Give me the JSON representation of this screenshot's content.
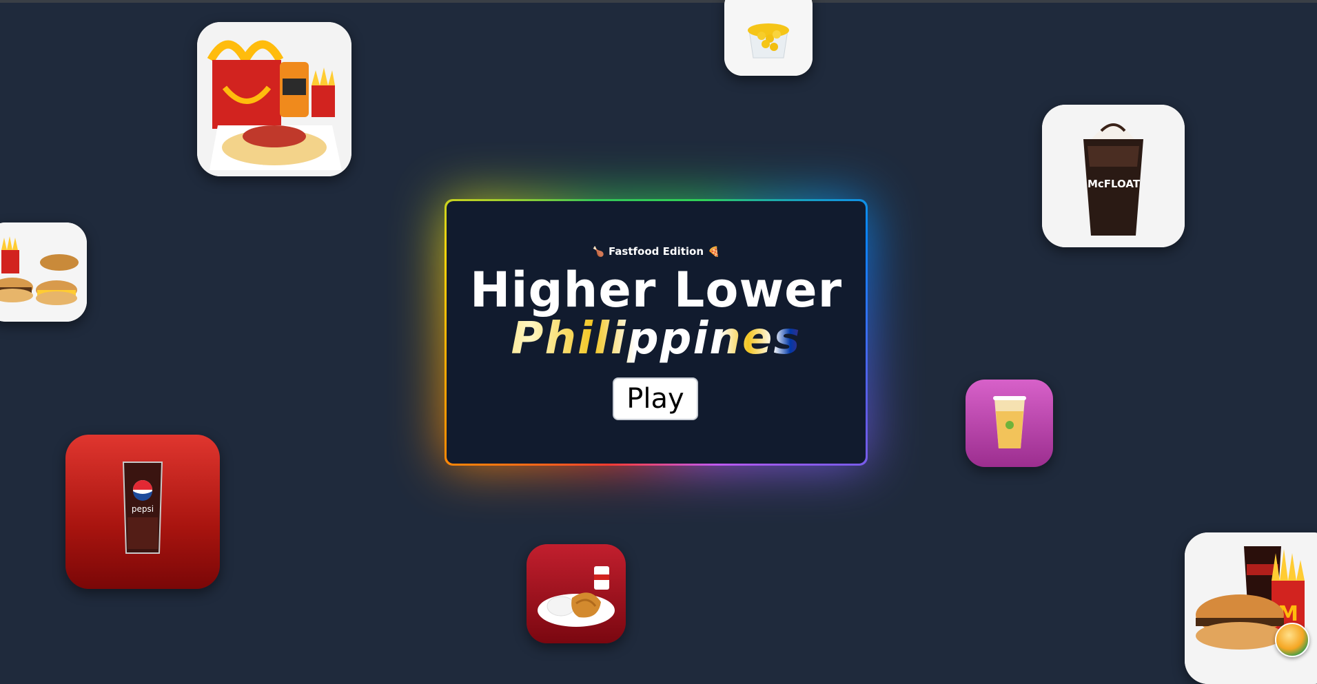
{
  "app": {
    "edition_label": "Fastfood Edition",
    "edition_icon_left": "🍗",
    "edition_icon_right": "🍕",
    "title_line1": "Higher Lower",
    "title_line2": "Philippines",
    "play_label": "Play"
  },
  "floating_items": [
    {
      "name": "happy-meal-spaghetti",
      "icon": "happy-meal-box"
    },
    {
      "name": "corn-cup",
      "icon": "corn-cup"
    },
    {
      "name": "mcfloat-drink",
      "icon": "float-drink",
      "label": "McFLOAT"
    },
    {
      "name": "burger-fries-platter",
      "icon": "burger-platter"
    },
    {
      "name": "pepsi-glass",
      "icon": "soda-glass",
      "label": "pepsi"
    },
    {
      "name": "mango-drink",
      "icon": "mango-drink"
    },
    {
      "name": "chicken-meal",
      "icon": "fried-chicken"
    },
    {
      "name": "burger-coke-fries",
      "icon": "burger-combo"
    }
  ],
  "colors": {
    "background": "#1f2a3c",
    "card": "#111b2e",
    "flag_yellow": "#f3c623",
    "flag_blue": "#0038a8",
    "flag_red": "#ce1126"
  }
}
